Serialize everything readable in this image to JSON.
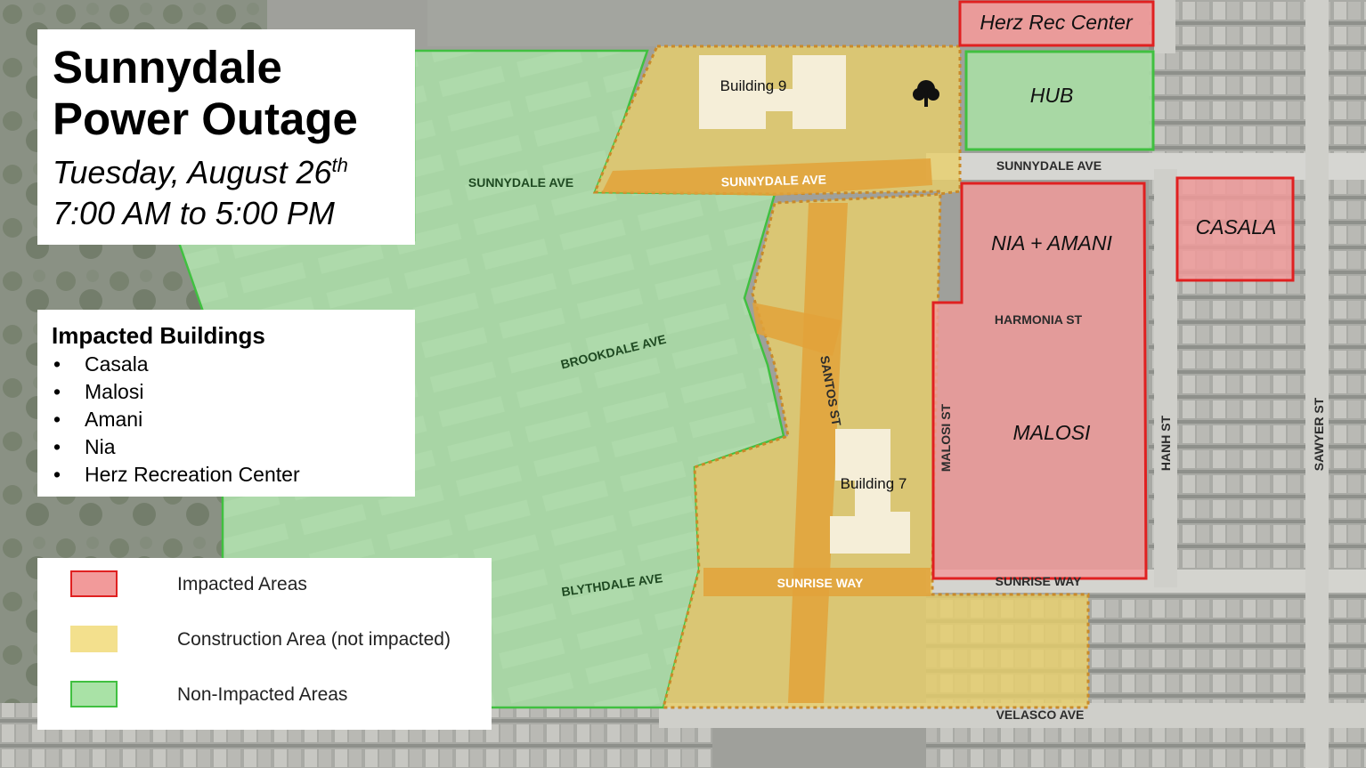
{
  "title": {
    "line1": "Sunnydale",
    "line2": "Power Outage",
    "date_main": "Tuesday, August 26",
    "date_suffix": "th",
    "time": "7:00 AM to 5:00 PM"
  },
  "impacted_buildings": {
    "heading": "Impacted Buildings",
    "items": [
      "Casala",
      "Malosi",
      "Amani",
      "Nia",
      "Herz Recreation Center"
    ]
  },
  "legend": {
    "items": [
      {
        "label": "Impacted Areas",
        "fill": "#f29a9a",
        "border": "#e02020"
      },
      {
        "label": "Construction Area (not impacted)",
        "fill": "#f3e08d",
        "border": "#f3e08d"
      },
      {
        "label": "Non-Impacted Areas",
        "fill": "#a9e2a6",
        "border": "#40c040"
      }
    ]
  },
  "areas": {
    "herz_rec_center": "Herz Rec Center",
    "hub": "HUB",
    "casala": "CASALA",
    "nia_amani": "NIA + AMANI",
    "malosi": "MALOSI"
  },
  "buildings": {
    "building9": "Building 9",
    "building7": "Building 7"
  },
  "streets": {
    "sunnydale_ave_west": "SUNNYDALE AVE",
    "sunnydale_ave_construction": "SUNNYDALE AVE",
    "sunnydale_ave_east": "SUNNYDALE AVE",
    "brookdale_ave": "BROOKDALE AVE",
    "blythdale_ave": "BLYTHDALE AVE",
    "santos_st": "SANTOS ST",
    "sunrise_way_construction": "SUNRISE WAY",
    "sunrise_way_east": "SUNRISE WAY",
    "harmonia_st": "HARMONIA ST",
    "malosi_st": "MALOSI ST",
    "hanh_st": "HANH ST",
    "sawyer_st": "SAWYER ST",
    "velasco_ave": "VELASCO AVE"
  },
  "colors": {
    "impacted_fill": "#f29a9a",
    "impacted_border": "#e02020",
    "construction_fill": "#e8cf6a",
    "construction_road": "#e2a23a",
    "construction_border": "#c98a2a",
    "non_impacted_fill": "#a9e2a6",
    "non_impacted_border": "#40c040"
  }
}
